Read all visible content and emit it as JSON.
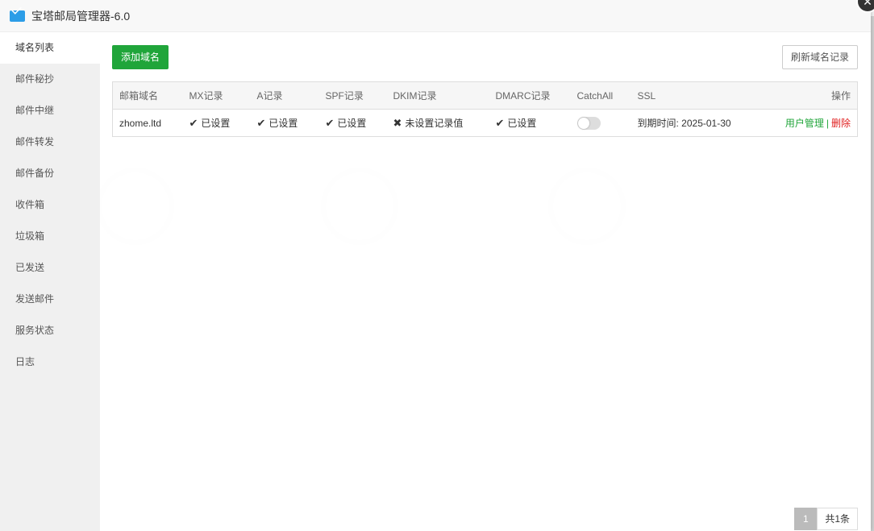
{
  "window": {
    "title": "宝塔邮局管理器-6.0"
  },
  "sidebar": {
    "items": [
      {
        "label": "域名列表",
        "active": true
      },
      {
        "label": "邮件秘抄"
      },
      {
        "label": "邮件中继"
      },
      {
        "label": "邮件转发"
      },
      {
        "label": "邮件备份"
      },
      {
        "label": "收件箱"
      },
      {
        "label": "垃圾箱"
      },
      {
        "label": "已发送"
      },
      {
        "label": "发送邮件"
      },
      {
        "label": "服务状态"
      },
      {
        "label": "日志"
      }
    ]
  },
  "toolbar": {
    "add_label": "添加域名",
    "refresh_label": "刷新域名记录"
  },
  "table": {
    "headers": [
      "邮箱域名",
      "MX记录",
      "A记录",
      "SPF记录",
      "DKIM记录",
      "DMARC记录",
      "CatchAll",
      "SSL",
      "操作"
    ],
    "rows": [
      {
        "domain": "zhome.ltd",
        "mx": "已设置",
        "a": "已设置",
        "spf": "已设置",
        "dkim": "未设置记录值",
        "dmarc": "已设置",
        "catchall": false,
        "ssl": "到期时间: 2025-01-30",
        "actions": {
          "users": "用户管理",
          "sep": "|",
          "delete": "删除"
        }
      }
    ]
  },
  "pager": {
    "current": "1",
    "total": "共1条"
  },
  "icons": {
    "ok": "✔",
    "bad": "✖",
    "close": "✕"
  },
  "colors": {
    "accent": "#20a53a",
    "danger": "#e02020",
    "title_icon": "#2c9de7"
  }
}
